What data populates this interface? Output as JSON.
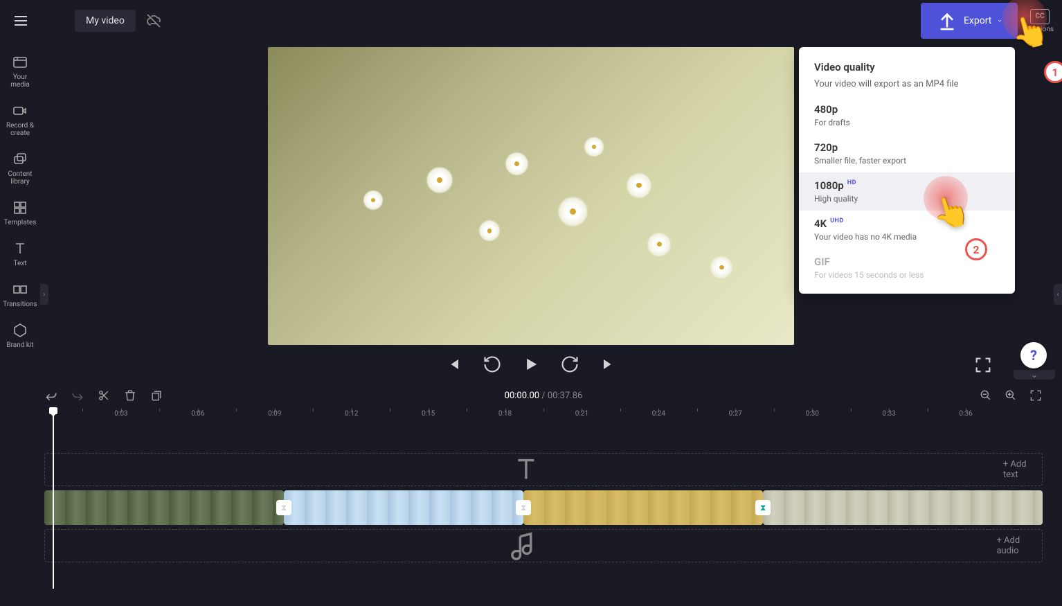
{
  "topbar": {
    "project_name": "My video",
    "export_label": "Export",
    "captions_label": "Captions"
  },
  "sidebar": {
    "items": [
      {
        "label": "Your media"
      },
      {
        "label": "Record & create"
      },
      {
        "label": "Content library"
      },
      {
        "label": "Templates"
      },
      {
        "label": "Text"
      },
      {
        "label": "Transitions"
      },
      {
        "label": "Brand kit"
      }
    ]
  },
  "export_popup": {
    "title": "Video quality",
    "subtitle": "Your video will export as an MP4 file",
    "options": [
      {
        "label": "480p",
        "desc": "For drafts",
        "badge": ""
      },
      {
        "label": "720p",
        "desc": "Smaller file, faster export",
        "badge": ""
      },
      {
        "label": "1080p",
        "desc": "High quality",
        "badge": "HD"
      },
      {
        "label": "4K",
        "desc": "Your video has no 4K media",
        "badge": "UHD"
      },
      {
        "label": "GIF",
        "desc": "For videos 15 seconds or less",
        "badge": ""
      }
    ]
  },
  "annotations": {
    "step1": "1",
    "step2": "2"
  },
  "timeline": {
    "current_time": "00:00.00",
    "total_time": "00:37.86",
    "separator": " / ",
    "ticks": [
      "0:03",
      "0:06",
      "0:09",
      "0:12",
      "0:15",
      "0:18",
      "0:21",
      "0:24",
      "0:27",
      "0:30",
      "0:33",
      "0:36"
    ],
    "add_text_label": "+  Add text",
    "add_audio_label": "+  Add audio"
  },
  "help": {
    "symbol": "?"
  },
  "icons": {
    "hamburger": "menu",
    "cloud_off": "cloud-off",
    "upload": "upload"
  }
}
